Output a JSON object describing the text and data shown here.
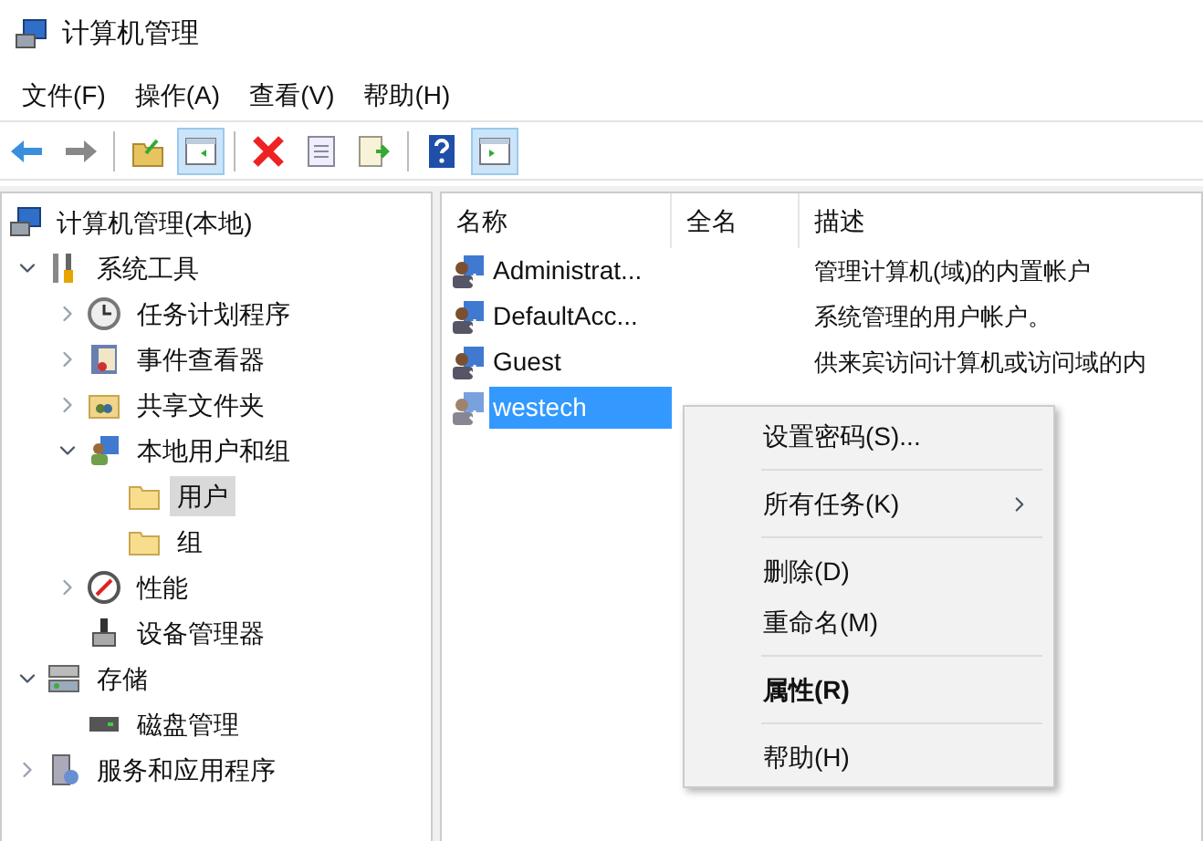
{
  "window": {
    "title": "计算机管理"
  },
  "menu": [
    "文件(F)",
    "操作(A)",
    "查看(V)",
    "帮助(H)"
  ],
  "toolbar": [
    {
      "kind": "button",
      "selected": false
    },
    {
      "kind": "button",
      "selected": false
    },
    {
      "kind": "separator"
    },
    {
      "kind": "button",
      "selected": false
    },
    {
      "kind": "button",
      "selected": true
    },
    {
      "kind": "separator"
    },
    {
      "kind": "button",
      "selected": false
    },
    {
      "kind": "button",
      "selected": false
    },
    {
      "kind": "button",
      "selected": false
    },
    {
      "kind": "separator"
    },
    {
      "kind": "button",
      "selected": false
    },
    {
      "kind": "button",
      "selected": true
    }
  ],
  "tree": [
    {
      "label": "计算机管理(本地)",
      "selected": false,
      "children": [
        {
          "label": "系统工具",
          "selected": false,
          "expanded": true,
          "children": [
            {
              "label": "任务计划程序",
              "selected": false,
              "expanded": false
            },
            {
              "label": "事件查看器",
              "selected": false,
              "expanded": false
            },
            {
              "label": "共享文件夹",
              "selected": false,
              "expanded": false
            },
            {
              "label": "本地用户和组",
              "selected": false,
              "expanded": true,
              "children": [
                {
                  "label": "用户",
                  "selected": true
                },
                {
                  "label": "组",
                  "selected": false
                }
              ]
            },
            {
              "label": "性能",
              "selected": false,
              "expanded": false
            },
            {
              "label": "设备管理器",
              "selected": false
            }
          ]
        },
        {
          "label": "存储",
          "selected": false,
          "expanded": true,
          "children": [
            {
              "label": "磁盘管理",
              "selected": false
            }
          ]
        },
        {
          "label": "服务和应用程序",
          "selected": false,
          "expanded": false
        }
      ]
    }
  ],
  "table": {
    "columns": [
      "名称",
      "全名",
      "描述"
    ],
    "rows": [
      {
        "name": "Administrat...",
        "description": "管理计算机(域)的内置帐户",
        "selected": false
      },
      {
        "name": "DefaultAcc...",
        "description": "系统管理的用户帐户。",
        "selected": false
      },
      {
        "name": "Guest",
        "description": "供来宾访问计算机或访问域的内",
        "selected": false
      },
      {
        "name": "westech",
        "selected": true
      }
    ]
  },
  "context_menu": [
    {
      "kind": "item",
      "label": "设置密码(S)...",
      "submenu": false,
      "default": false
    },
    {
      "kind": "separator"
    },
    {
      "kind": "item",
      "label": "所有任务(K)",
      "submenu": true,
      "default": false
    },
    {
      "kind": "separator"
    },
    {
      "kind": "item",
      "label": "删除(D)",
      "submenu": false,
      "default": false
    },
    {
      "kind": "item",
      "label": "重命名(M)",
      "submenu": false,
      "default": false
    },
    {
      "kind": "separator"
    },
    {
      "kind": "item",
      "label": "属性(R)",
      "submenu": false,
      "default": true
    },
    {
      "kind": "separator"
    },
    {
      "kind": "item",
      "label": "帮助(H)",
      "submenu": false,
      "default": false
    }
  ]
}
